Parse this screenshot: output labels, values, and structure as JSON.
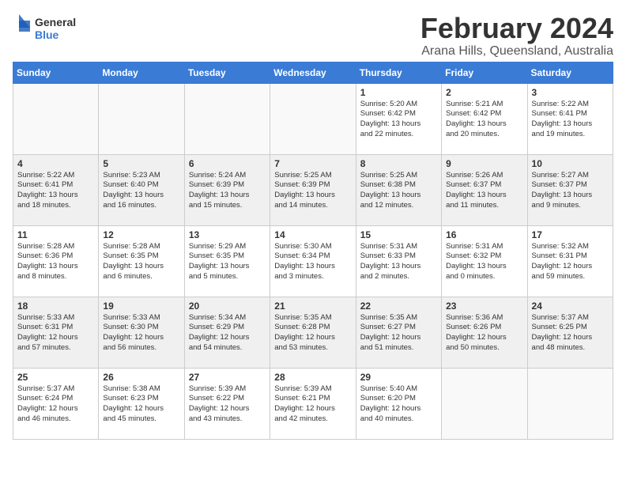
{
  "logo": {
    "general": "General",
    "blue": "Blue"
  },
  "title": "February 2024",
  "location": "Arana Hills, Queensland, Australia",
  "days_of_week": [
    "Sunday",
    "Monday",
    "Tuesday",
    "Wednesday",
    "Thursday",
    "Friday",
    "Saturday"
  ],
  "weeks": [
    [
      {
        "day": "",
        "info": ""
      },
      {
        "day": "",
        "info": ""
      },
      {
        "day": "",
        "info": ""
      },
      {
        "day": "",
        "info": ""
      },
      {
        "day": "1",
        "info": "Sunrise: 5:20 AM\nSunset: 6:42 PM\nDaylight: 13 hours\nand 22 minutes."
      },
      {
        "day": "2",
        "info": "Sunrise: 5:21 AM\nSunset: 6:42 PM\nDaylight: 13 hours\nand 20 minutes."
      },
      {
        "day": "3",
        "info": "Sunrise: 5:22 AM\nSunset: 6:41 PM\nDaylight: 13 hours\nand 19 minutes."
      }
    ],
    [
      {
        "day": "4",
        "info": "Sunrise: 5:22 AM\nSunset: 6:41 PM\nDaylight: 13 hours\nand 18 minutes."
      },
      {
        "day": "5",
        "info": "Sunrise: 5:23 AM\nSunset: 6:40 PM\nDaylight: 13 hours\nand 16 minutes."
      },
      {
        "day": "6",
        "info": "Sunrise: 5:24 AM\nSunset: 6:39 PM\nDaylight: 13 hours\nand 15 minutes."
      },
      {
        "day": "7",
        "info": "Sunrise: 5:25 AM\nSunset: 6:39 PM\nDaylight: 13 hours\nand 14 minutes."
      },
      {
        "day": "8",
        "info": "Sunrise: 5:25 AM\nSunset: 6:38 PM\nDaylight: 13 hours\nand 12 minutes."
      },
      {
        "day": "9",
        "info": "Sunrise: 5:26 AM\nSunset: 6:37 PM\nDaylight: 13 hours\nand 11 minutes."
      },
      {
        "day": "10",
        "info": "Sunrise: 5:27 AM\nSunset: 6:37 PM\nDaylight: 13 hours\nand 9 minutes."
      }
    ],
    [
      {
        "day": "11",
        "info": "Sunrise: 5:28 AM\nSunset: 6:36 PM\nDaylight: 13 hours\nand 8 minutes."
      },
      {
        "day": "12",
        "info": "Sunrise: 5:28 AM\nSunset: 6:35 PM\nDaylight: 13 hours\nand 6 minutes."
      },
      {
        "day": "13",
        "info": "Sunrise: 5:29 AM\nSunset: 6:35 PM\nDaylight: 13 hours\nand 5 minutes."
      },
      {
        "day": "14",
        "info": "Sunrise: 5:30 AM\nSunset: 6:34 PM\nDaylight: 13 hours\nand 3 minutes."
      },
      {
        "day": "15",
        "info": "Sunrise: 5:31 AM\nSunset: 6:33 PM\nDaylight: 13 hours\nand 2 minutes."
      },
      {
        "day": "16",
        "info": "Sunrise: 5:31 AM\nSunset: 6:32 PM\nDaylight: 13 hours\nand 0 minutes."
      },
      {
        "day": "17",
        "info": "Sunrise: 5:32 AM\nSunset: 6:31 PM\nDaylight: 12 hours\nand 59 minutes."
      }
    ],
    [
      {
        "day": "18",
        "info": "Sunrise: 5:33 AM\nSunset: 6:31 PM\nDaylight: 12 hours\nand 57 minutes."
      },
      {
        "day": "19",
        "info": "Sunrise: 5:33 AM\nSunset: 6:30 PM\nDaylight: 12 hours\nand 56 minutes."
      },
      {
        "day": "20",
        "info": "Sunrise: 5:34 AM\nSunset: 6:29 PM\nDaylight: 12 hours\nand 54 minutes."
      },
      {
        "day": "21",
        "info": "Sunrise: 5:35 AM\nSunset: 6:28 PM\nDaylight: 12 hours\nand 53 minutes."
      },
      {
        "day": "22",
        "info": "Sunrise: 5:35 AM\nSunset: 6:27 PM\nDaylight: 12 hours\nand 51 minutes."
      },
      {
        "day": "23",
        "info": "Sunrise: 5:36 AM\nSunset: 6:26 PM\nDaylight: 12 hours\nand 50 minutes."
      },
      {
        "day": "24",
        "info": "Sunrise: 5:37 AM\nSunset: 6:25 PM\nDaylight: 12 hours\nand 48 minutes."
      }
    ],
    [
      {
        "day": "25",
        "info": "Sunrise: 5:37 AM\nSunset: 6:24 PM\nDaylight: 12 hours\nand 46 minutes."
      },
      {
        "day": "26",
        "info": "Sunrise: 5:38 AM\nSunset: 6:23 PM\nDaylight: 12 hours\nand 45 minutes."
      },
      {
        "day": "27",
        "info": "Sunrise: 5:39 AM\nSunset: 6:22 PM\nDaylight: 12 hours\nand 43 minutes."
      },
      {
        "day": "28",
        "info": "Sunrise: 5:39 AM\nSunset: 6:21 PM\nDaylight: 12 hours\nand 42 minutes."
      },
      {
        "day": "29",
        "info": "Sunrise: 5:40 AM\nSunset: 6:20 PM\nDaylight: 12 hours\nand 40 minutes."
      },
      {
        "day": "",
        "info": ""
      },
      {
        "day": "",
        "info": ""
      }
    ]
  ]
}
